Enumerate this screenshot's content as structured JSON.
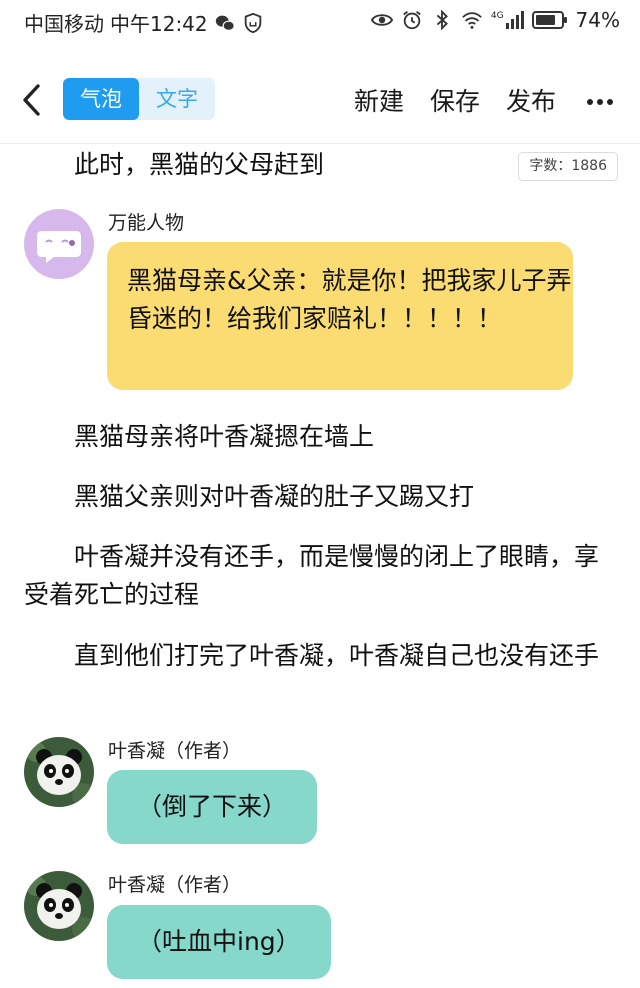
{
  "status_bar": {
    "carrier": "中国移动",
    "time": "中午12:42",
    "network": "4G",
    "battery": "74%"
  },
  "toolbar": {
    "tab_bubble": "气泡",
    "tab_text": "文字",
    "new_label": "新建",
    "save_label": "保存",
    "publish_label": "发布"
  },
  "word_count": "字数：1886",
  "content": {
    "para_intro": "此时，黑猫的父母赶到",
    "bubble1": {
      "speaker": "万能人物",
      "text": "黑猫母亲&父亲：就是你！把我家儿子弄昏迷的！给我们家赔礼！！！！！"
    },
    "para1": "黑猫母亲将叶香凝摁在墙上",
    "para2": "黑猫父亲则对叶香凝的肚子又踢又打",
    "para3": "叶香凝并没有还手，而是慢慢的闭上了眼睛，享受着死亡的过程",
    "para4": "直到他们打完了叶香凝，叶香凝自己也没有还手",
    "bubble2": {
      "speaker": "叶香凝（作者）",
      "text": "（倒了下来）"
    },
    "bubble3": {
      "speaker": "叶香凝（作者）",
      "text": "（吐血中ing）"
    }
  },
  "colors": {
    "accent_blue": "#1f9cf0",
    "bubble_yellow": "#fbdc72",
    "bubble_teal": "#86d8cb",
    "avatar_purple": "#d6b8ec"
  }
}
